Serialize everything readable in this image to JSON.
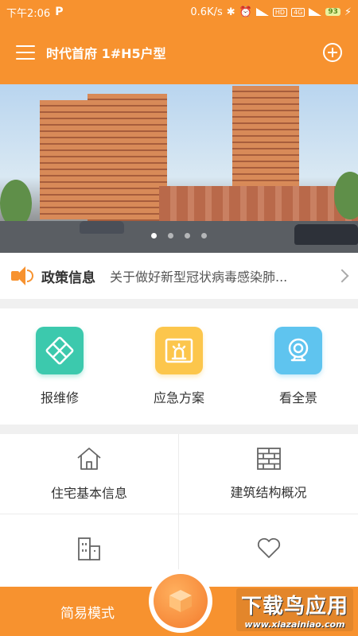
{
  "status": {
    "time": "下午2:06",
    "speed": "0.6K/s",
    "net_tag": "4G",
    "hd_tag": "HD",
    "battery": "93"
  },
  "header": {
    "title": "时代首府 1#H5户型"
  },
  "banner": {
    "slides": 4,
    "active_slide": 1
  },
  "notice": {
    "label": "政策信息",
    "text": "关于做好新型冠状病毒感染肺..."
  },
  "quick_actions": [
    {
      "label": "报维修",
      "icon": "repair-tools-icon",
      "color": "#3cc9ad"
    },
    {
      "label": "应急方案",
      "icon": "alarm-light-icon",
      "color": "#fcc64c"
    },
    {
      "label": "看全景",
      "icon": "camera-icon",
      "color": "#5fc4ef"
    }
  ],
  "grid_items": [
    {
      "label": "住宅基本信息",
      "icon": "house-icon"
    },
    {
      "label": "建筑结构概况",
      "icon": "brick-wall-icon"
    },
    {
      "label": "",
      "icon": "building-icon"
    },
    {
      "label": "",
      "icon": "heart-icon"
    }
  ],
  "bottom": {
    "mode_label": "简易模式"
  },
  "watermark": {
    "main": "下载鸟应用",
    "sub": "www.xiazainiao.com"
  },
  "colors": {
    "primary": "#f7922f"
  }
}
